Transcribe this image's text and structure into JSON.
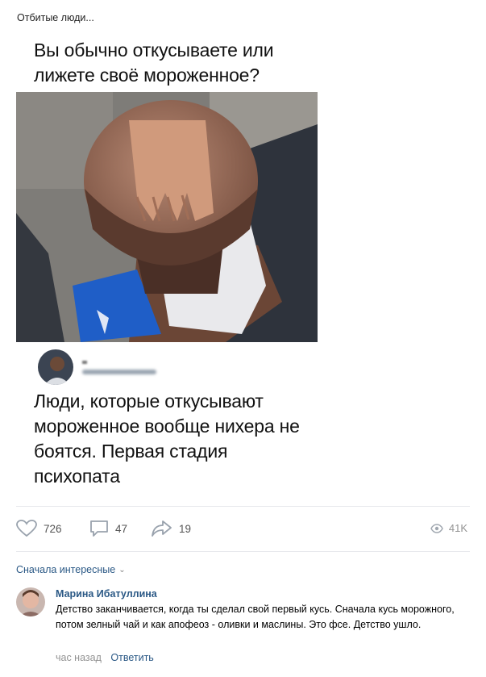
{
  "post": {
    "caption": "Отбитые люди...",
    "meme": {
      "question": "Вы обычно откусываете или лижете своё мороженное?",
      "tweet_text": "Люди, которые откусывают мороженное вообще нихера не боятся. Первая стадия психопата"
    },
    "actions": {
      "likes": "726",
      "comments": "47",
      "shares": "19",
      "views": "41K"
    }
  },
  "comments": {
    "sort_label": "Сначала интересные",
    "items": [
      {
        "author": "Марина Ибатуллина",
        "text": "Детство заканчивается, когда ты сделал свой первый кусь. Сначала кусь морожного, потом зелный чай и как апофеоз - оливки и маслины. Это фсе. Детство ушло.",
        "time": "час назад",
        "reply_label": "Ответить"
      }
    ]
  },
  "colors": {
    "link": "#2a5885",
    "muted": "#939393",
    "divider": "#e7e8ec"
  },
  "icons": [
    "heart-icon",
    "comment-icon",
    "share-icon",
    "eye-icon",
    "chevron-down-icon"
  ]
}
